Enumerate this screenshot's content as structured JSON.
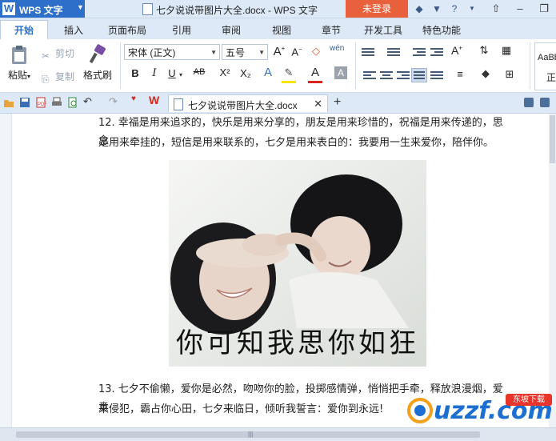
{
  "titlebar": {
    "app_name": "WPS 文字",
    "app_logo": "W",
    "doc_title": "七夕说说带图片大全.docx - WPS 文字",
    "login": "未登录",
    "icons": [
      "skin-icon",
      "shirt-icon",
      "help-icon",
      "pin-icon"
    ],
    "help_glyph": "?"
  },
  "ribbon_tabs": [
    "开始",
    "插入",
    "页面布局",
    "引用",
    "审阅",
    "视图",
    "章节",
    "开发工具",
    "特色功能"
  ],
  "ribbon": {
    "paste": "粘贴",
    "cut": "剪切",
    "copy": "复制",
    "format_painter": "格式刷",
    "font_name": "宋体 (正文)",
    "font_size": "五号",
    "bold": "B",
    "italic": "I",
    "underline": "U",
    "strike": "AB",
    "superscript": "X²",
    "subscript": "X₂",
    "font_color_letter": "A",
    "style_preview": "AaBb",
    "style_name": "正"
  },
  "doc_tab": {
    "name": "七夕说说带图片大全.docx"
  },
  "document": {
    "para12_line1": "12. 幸福是用来追求的，快乐是用来分享的，朋友是用来珍惜的，祝福是用来传递的，思念",
    "para12_line2": "是用来牵挂的，短信是用来联系的，七夕是用来表白的：我要用一生来爱你，陪伴你。",
    "image_caption": "你可知我思你如狂",
    "para13_line1": "13. 七夕不偷懒，爱你是必然，吻吻你的脸，投掷感情弹，悄悄把手牵，释放浪漫烟，爱意",
    "para13_line2": "来侵犯，霸占你心田，七夕来临日，倾听我誓言：爱你到永远!"
  },
  "watermark": {
    "text": "uzzf.com",
    "badge": "东坡下载"
  },
  "colors": {
    "accent": "#2e6fc9",
    "login_button": "#e8613c",
    "titlebar_bg": "#dde9f6"
  }
}
